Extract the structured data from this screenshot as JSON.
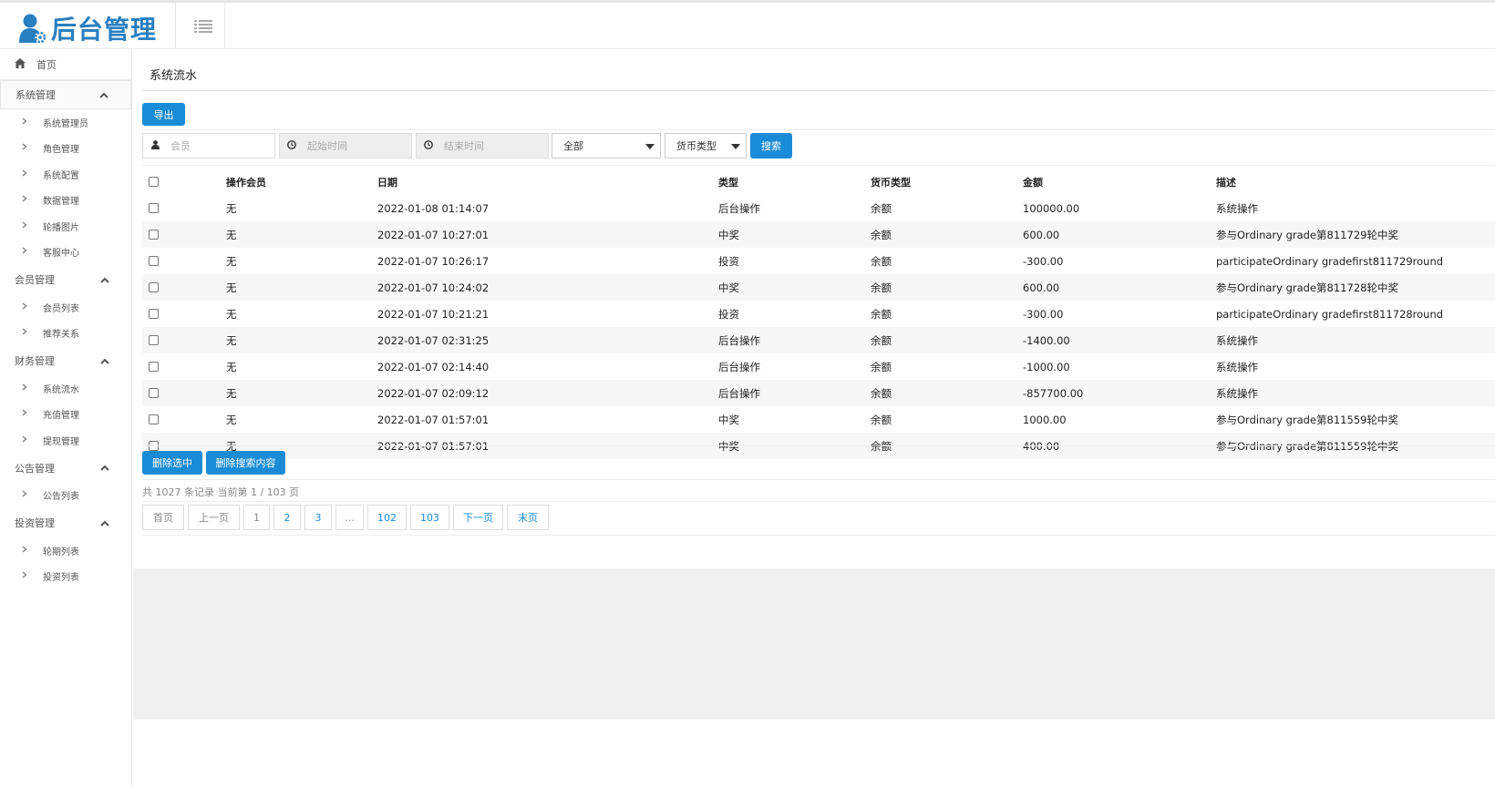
{
  "header": {
    "logo_text": "后台管理",
    "menu_icon": "list-icon"
  },
  "sidebar": {
    "home": "首页",
    "groups": [
      {
        "label": "系统管理",
        "items": [
          "系统管理员",
          "角色管理",
          "系统配置",
          "数据管理",
          "轮播图片",
          "客服中心"
        ]
      },
      {
        "label": "会员管理",
        "items": [
          "会员列表",
          "推荐关系"
        ]
      },
      {
        "label": "财务管理",
        "items": [
          "系统流水",
          "充值管理",
          "提现管理"
        ]
      },
      {
        "label": "公告管理",
        "items": [
          "公告列表"
        ]
      },
      {
        "label": "投资管理",
        "items": [
          "轮期列表",
          "投资列表"
        ]
      }
    ]
  },
  "page": {
    "title": "系统流水",
    "export_label": "导出"
  },
  "search": {
    "member_placeholder": "会员",
    "start_placeholder": "起始时间",
    "end_placeholder": "结束时间",
    "type_selected": "全部",
    "currency_selected": "货币类型",
    "search_label": "搜索"
  },
  "table": {
    "headers": {
      "member": "操作会员",
      "date": "日期",
      "type": "类型",
      "currency": "货币类型",
      "amount": "金额",
      "desc": "描述"
    },
    "rows": [
      {
        "member": "无",
        "date": "2022-01-08 01:14:07",
        "type": "后台操作",
        "currency": "余额",
        "amount": "100000.00",
        "desc": "系统操作"
      },
      {
        "member": "无",
        "date": "2022-01-07 10:27:01",
        "type": "中奖",
        "currency": "余额",
        "amount": "600.00",
        "desc": "参与Ordinary grade第811729轮中奖"
      },
      {
        "member": "无",
        "date": "2022-01-07 10:26:17",
        "type": "投资",
        "currency": "余额",
        "amount": "-300.00",
        "desc": "participateOrdinary gradefirst811729round"
      },
      {
        "member": "无",
        "date": "2022-01-07 10:24:02",
        "type": "中奖",
        "currency": "余额",
        "amount": "600.00",
        "desc": "参与Ordinary grade第811728轮中奖"
      },
      {
        "member": "无",
        "date": "2022-01-07 10:21:21",
        "type": "投资",
        "currency": "余额",
        "amount": "-300.00",
        "desc": "participateOrdinary gradefirst811728round"
      },
      {
        "member": "无",
        "date": "2022-01-07 02:31:25",
        "type": "后台操作",
        "currency": "余额",
        "amount": "-1400.00",
        "desc": "系统操作"
      },
      {
        "member": "无",
        "date": "2022-01-07 02:14:40",
        "type": "后台操作",
        "currency": "余额",
        "amount": "-1000.00",
        "desc": "系统操作"
      },
      {
        "member": "无",
        "date": "2022-01-07 02:09:12",
        "type": "后台操作",
        "currency": "余额",
        "amount": "-857700.00",
        "desc": "系统操作"
      },
      {
        "member": "无",
        "date": "2022-01-07 01:57:01",
        "type": "中奖",
        "currency": "余额",
        "amount": "1000.00",
        "desc": "参与Ordinary grade第811559轮中奖"
      },
      {
        "member": "无",
        "date": "2022-01-07 01:57:01",
        "type": "中奖",
        "currency": "余额",
        "amount": "400.00",
        "desc": "参与Ordinary grade第811559轮中奖"
      }
    ]
  },
  "actions": {
    "delete_selected": "删除选中",
    "delete_search": "删除搜索内容"
  },
  "pagination": {
    "info": "共 1027 条记录   当前第 1  /  103 页",
    "first": "首页",
    "prev": "上一页",
    "pages": [
      "1",
      "2",
      "3",
      "...",
      "102",
      "103"
    ],
    "next": "下一页",
    "last": "末页"
  },
  "colors": {
    "accent": "#1a8bd6",
    "logo": "#2a7fc0"
  }
}
